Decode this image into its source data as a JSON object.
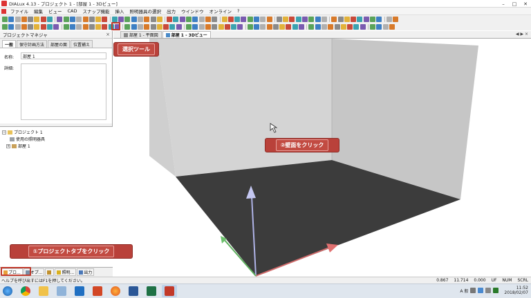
{
  "window": {
    "title": "DIALux 4.13 - プロジェクト 1 - [部屋 1 - 3Dビュー]"
  },
  "menu": [
    "ファイル",
    "編集",
    "ビュー",
    "CAD",
    "スナップ機能",
    "挿入",
    "照明器具の選択",
    "出力",
    "ウインドウ",
    "オンライン",
    "?"
  ],
  "project_manager": {
    "title": "プロジェクトマネジャ",
    "tabs": [
      "一般",
      "保守計画方法",
      "部屋の面",
      "位置補え"
    ],
    "name_label": "名称:",
    "name_value": "部屋 1",
    "desc_label": "詳細:",
    "tree": {
      "root": "プロジェクト 1",
      "child1": "使用の照明器具",
      "child2": "部屋 1"
    },
    "bottom_tabs": [
      "プロ...",
      "オプ...",
      "",
      "照明...",
      "出力"
    ]
  },
  "view_tabs": [
    "部屋 1 - 平面図",
    "部屋 1 - 3Dビュー"
  ],
  "callouts": {
    "select_tool": "選択ツール",
    "click_wall": "②壁面をクリック",
    "click_project_tab": "①プロジェクトタブをクリック"
  },
  "status": {
    "help": "ヘルプを呼び出すにはF1を押してください。",
    "v1": "0.867",
    "v2": "11.714",
    "v3": "0.000",
    "uf": "UF",
    "num": "NUM",
    "scrl": "SCRL"
  },
  "tray": {
    "ime": "A 般",
    "time": "11:52",
    "date": "2018/02/07"
  },
  "colors": {
    "accent": "#b9413a",
    "floor": "#3c3c3c",
    "wall_back": "#d3d3d3",
    "wall_left": "#bdbdbd",
    "wall_right": "#c9c9c9"
  }
}
